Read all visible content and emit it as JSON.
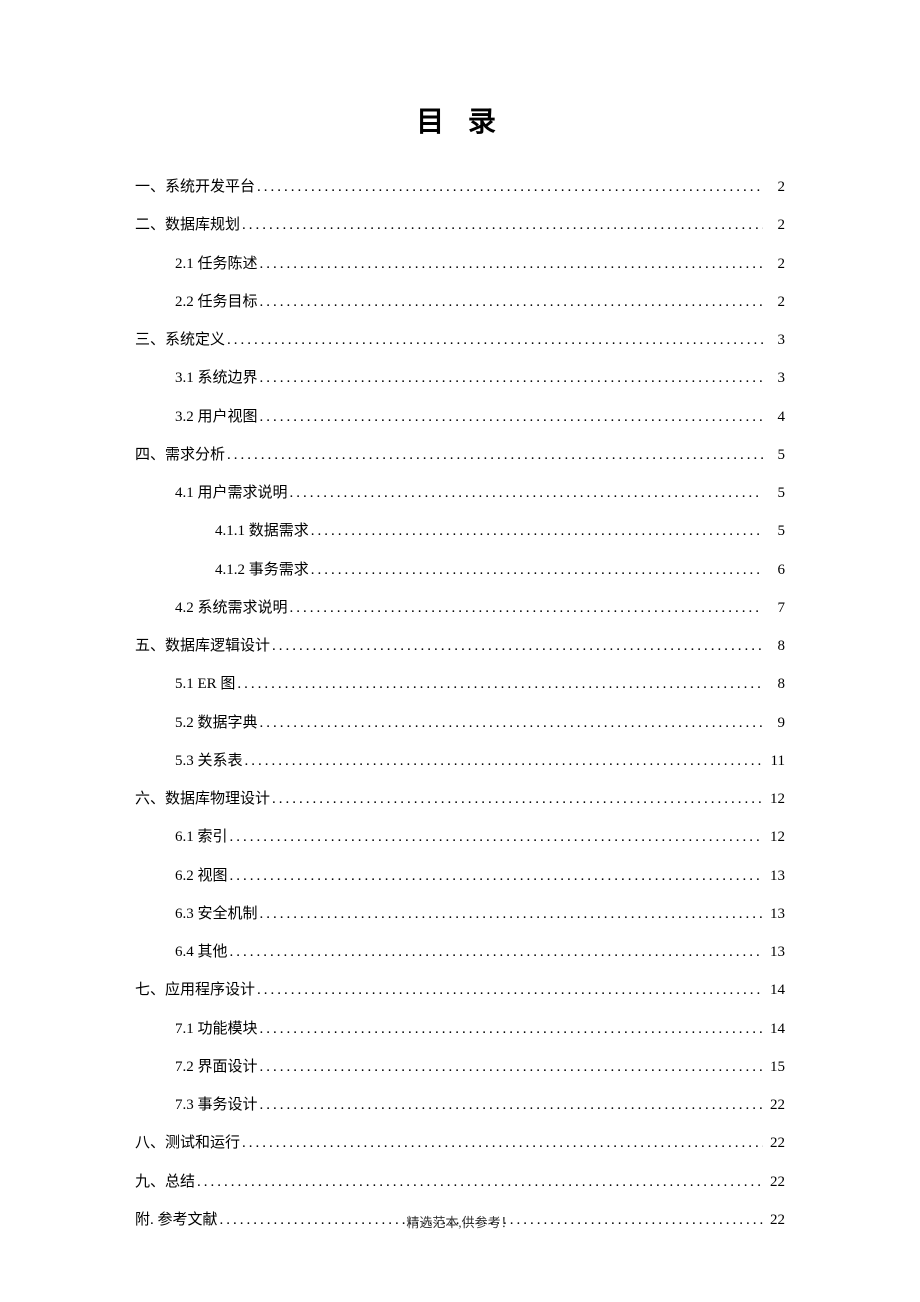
{
  "title": "目 录",
  "footer": "精选范本,供参考！",
  "entries": [
    {
      "level": 1,
      "label": "一、系统开发平台",
      "page": "2"
    },
    {
      "level": 1,
      "label": "二、数据库规划",
      "page": "2"
    },
    {
      "level": 2,
      "label": "2.1 任务陈述",
      "page": "2"
    },
    {
      "level": 2,
      "label": "2.2 任务目标",
      "page": "2"
    },
    {
      "level": 1,
      "label": "三、系统定义",
      "page": "3"
    },
    {
      "level": 2,
      "label": "3.1 系统边界",
      "page": "3"
    },
    {
      "level": 2,
      "label": "3.2 用户视图",
      "page": "4"
    },
    {
      "level": 1,
      "label": "四、需求分析",
      "page": "5"
    },
    {
      "level": 2,
      "label": "4.1 用户需求说明",
      "page": "5"
    },
    {
      "level": 3,
      "label": "4.1.1 数据需求",
      "page": "5"
    },
    {
      "level": 3,
      "label": "4.1.2 事务需求",
      "page": "6"
    },
    {
      "level": 2,
      "label": "4.2 系统需求说明",
      "page": "7"
    },
    {
      "level": 1,
      "label": "五、数据库逻辑设计",
      "page": "8"
    },
    {
      "level": 2,
      "label": "5.1 ER 图",
      "page": "8"
    },
    {
      "level": 2,
      "label": "5.2 数据字典",
      "page": "9"
    },
    {
      "level": 2,
      "label": "5.3 关系表",
      "page": "11"
    },
    {
      "level": 1,
      "label": "六、数据库物理设计",
      "page": "12"
    },
    {
      "level": 2,
      "label": "6.1 索引",
      "page": "12"
    },
    {
      "level": 2,
      "label": "6.2 视图",
      "page": "13"
    },
    {
      "level": 2,
      "label": "6.3 安全机制",
      "page": "13"
    },
    {
      "level": 2,
      "label": "6.4 其他",
      "page": "13"
    },
    {
      "level": 1,
      "label": "七、应用程序设计",
      "page": "14"
    },
    {
      "level": 2,
      "label": "7.1 功能模块",
      "page": "14"
    },
    {
      "level": 2,
      "label": "7.2 界面设计",
      "page": "15"
    },
    {
      "level": 2,
      "label": "7.3 事务设计",
      "page": "22"
    },
    {
      "level": 1,
      "label": "八、测试和运行",
      "page": "22"
    },
    {
      "level": 1,
      "label": "九、总结",
      "page": "22"
    },
    {
      "level": 1,
      "label": "附. 参考文献",
      "page": "22"
    }
  ]
}
